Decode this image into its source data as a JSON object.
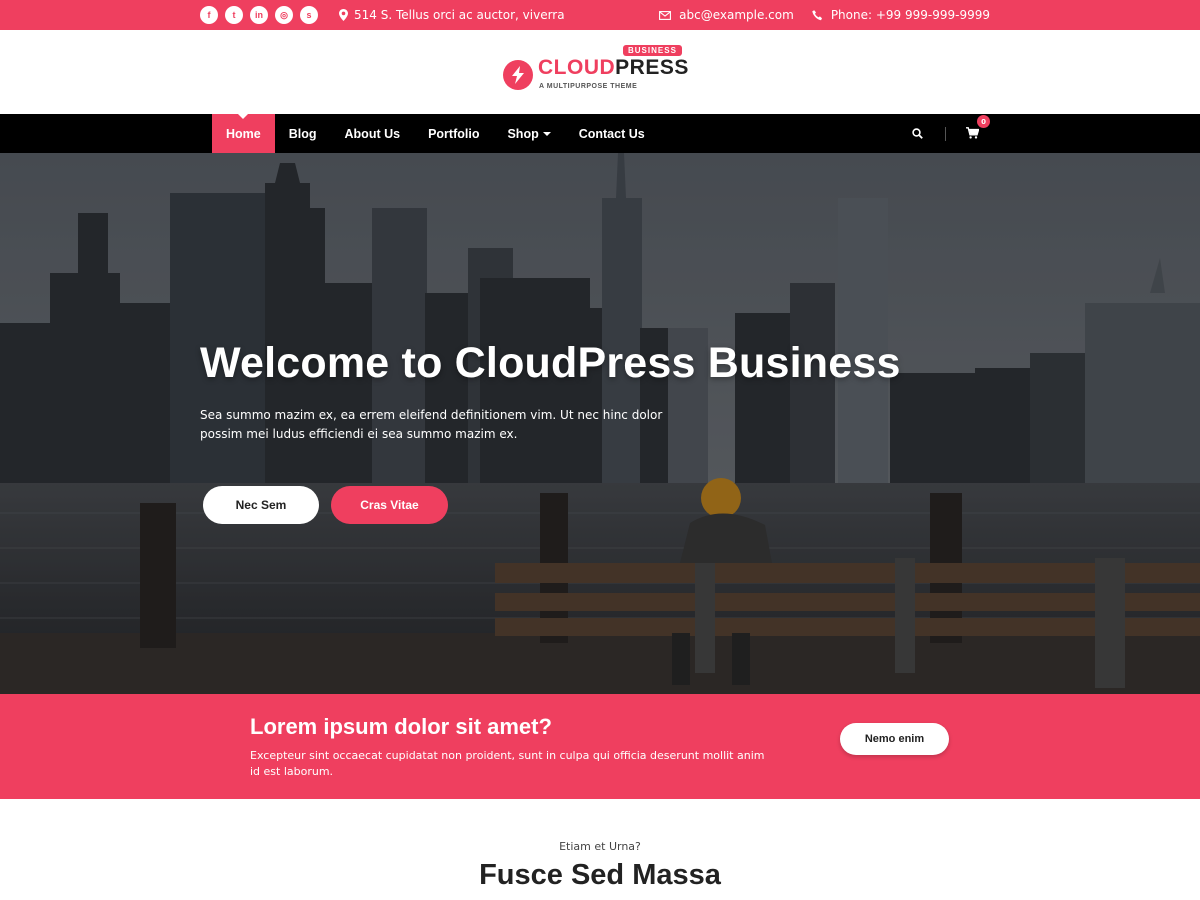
{
  "topbar": {
    "social_icons": [
      "facebook-icon",
      "twitter-icon",
      "linkedin-icon",
      "instagram-icon",
      "skype-icon"
    ],
    "social_glyphs": [
      "f",
      "t",
      "in",
      "◎",
      "s"
    ],
    "address": "514 S. Tellus orci ac auctor, viverra",
    "email": "abc@example.com",
    "phone": "Phone: +99 999-999-9999"
  },
  "logo": {
    "badge": "BUSINESS",
    "name_part1": "CLOUD",
    "name_part2": "PRESS",
    "tagline": "A MULTIPURPOSE THEME"
  },
  "nav": {
    "items": [
      "Home",
      "Blog",
      "About Us",
      "Portfolio",
      "Shop",
      "Contact Us"
    ],
    "active_index": 0,
    "cart_count": "0"
  },
  "hero": {
    "title": "Welcome to CloudPress Business",
    "text": "Sea summo mazim ex, ea errem eleifend definitionem vim. Ut nec hinc dolor possim mei ludus efficiendi ei sea summo mazim ex.",
    "button1": "Nec Sem",
    "button2": "Cras Vitae"
  },
  "cta": {
    "title": "Lorem ipsum dolor sit amet?",
    "text": "Excepteur sint occaecat cupidatat non proident, sunt in culpa qui officia deserunt mollit anim id est laborum.",
    "button": "Nemo enim"
  },
  "section": {
    "subtitle": "Etiam et Urna?",
    "title": "Fusce Sed Massa"
  },
  "colors": {
    "accent": "#ef3f5f",
    "nav_bg": "#000000"
  }
}
